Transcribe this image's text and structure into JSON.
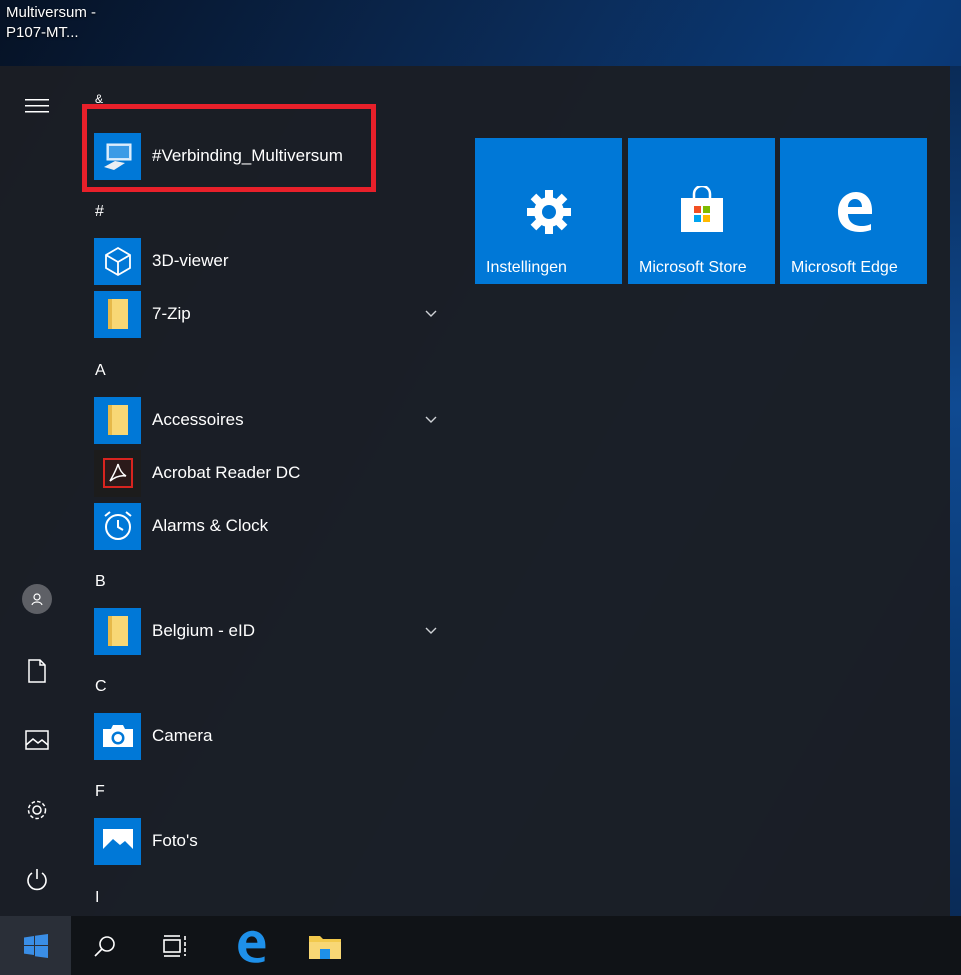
{
  "desktop": {
    "shortcut_label": "Multiversum - P107-MT..."
  },
  "start_menu": {
    "rail": {
      "menu_icon": "hamburger-icon",
      "account_icon": "user-icon",
      "documents_icon": "document-icon",
      "pictures_icon": "pictures-icon",
      "settings_icon": "gear-icon",
      "power_icon": "power-icon"
    },
    "sections": [
      {
        "letter": "&",
        "apps": [
          {
            "name": "#Verbinding_Multiversum",
            "icon": "remote-desktop-icon",
            "expandable": false
          }
        ]
      },
      {
        "letter": "#",
        "apps": [
          {
            "name": "3D-viewer",
            "icon": "cube-icon",
            "expandable": false
          },
          {
            "name": "7-Zip",
            "icon": "folder-icon",
            "expandable": true
          }
        ]
      },
      {
        "letter": "A",
        "apps": [
          {
            "name": "Accessoires",
            "icon": "folder-icon",
            "expandable": true
          },
          {
            "name": "Acrobat Reader DC",
            "icon": "acrobat-icon",
            "expandable": false
          },
          {
            "name": "Alarms & Clock",
            "icon": "alarm-clock-icon",
            "expandable": false
          }
        ]
      },
      {
        "letter": "B",
        "apps": [
          {
            "name": "Belgium - eID",
            "icon": "folder-icon",
            "expandable": true
          }
        ]
      },
      {
        "letter": "C",
        "apps": [
          {
            "name": "Camera",
            "icon": "camera-icon",
            "expandable": false
          }
        ]
      },
      {
        "letter": "F",
        "apps": [
          {
            "name": "Foto's",
            "icon": "photos-icon",
            "expandable": false
          }
        ]
      },
      {
        "letter": "I",
        "apps": []
      }
    ],
    "tiles": [
      {
        "label": "Instellingen",
        "icon": "gear-icon"
      },
      {
        "label": "Microsoft Store",
        "icon": "store-icon"
      },
      {
        "label": "Microsoft Edge",
        "icon": "edge-icon"
      }
    ]
  },
  "taskbar": {
    "items": [
      "windows-start-icon",
      "search-icon",
      "task-view-icon",
      "edge-icon",
      "file-explorer-icon"
    ]
  },
  "colors": {
    "accent": "#0078d7",
    "highlight": "#e8202a",
    "menu_bg": "#1b1e24",
    "taskbar_bg": "#101317"
  }
}
